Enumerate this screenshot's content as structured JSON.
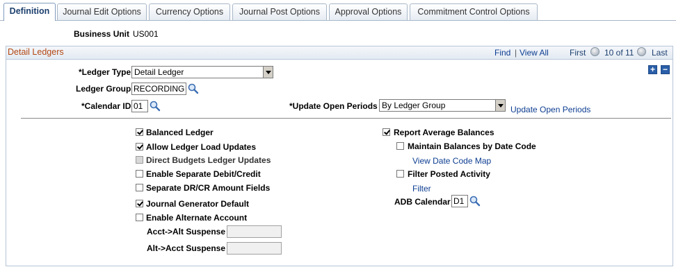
{
  "tabs": [
    {
      "label": "Definition",
      "active": true
    },
    {
      "label": "Journal Edit Options",
      "active": false
    },
    {
      "label": "Currency Options",
      "active": false
    },
    {
      "label": "Journal Post Options",
      "active": false
    },
    {
      "label": "Approval Options",
      "active": false
    },
    {
      "label": "Commitment Control Options",
      "active": false
    }
  ],
  "business_unit": {
    "label": "Business Unit",
    "value": "US001"
  },
  "detail_ledgers": {
    "title": "Detail Ledgers",
    "find": "Find",
    "view_all": "View All",
    "separator": "|",
    "first": "First",
    "counter": "10 of 11",
    "last": "Last",
    "ledger_type": {
      "label": "*Ledger Type",
      "value": "Detail Ledger"
    },
    "ledger_group": {
      "label": "Ledger Group",
      "value": "RECORDING"
    },
    "calendar_id": {
      "label": "*Calendar ID",
      "value": "01"
    },
    "update_open_periods": {
      "label": "*Update Open Periods",
      "value": "By Ledger Group",
      "link": "Update Open Periods"
    }
  },
  "left_options": {
    "balanced_ledger": {
      "label": "Balanced Ledger",
      "checked": true
    },
    "allow_load_updates": {
      "label": "Allow Ledger Load Updates",
      "checked": true
    },
    "direct_budgets": {
      "label": "Direct Budgets Ledger Updates",
      "checked": false,
      "disabled": true
    },
    "separate_debit_credit": {
      "label": "Enable Separate Debit/Credit",
      "checked": false
    },
    "separate_amount_fields": {
      "label": "Separate DR/CR Amount Fields",
      "checked": false
    },
    "journal_generator_default": {
      "label": "Journal Generator Default",
      "checked": true
    },
    "alternate_account": {
      "label": "Enable Alternate Account",
      "checked": false
    },
    "acct_alt_suspense": {
      "label": "Acct->Alt Suspense",
      "value": ""
    },
    "alt_acct_suspense": {
      "label": "Alt->Acct Suspense",
      "value": ""
    }
  },
  "right_options": {
    "report_average_balances": {
      "label": "Report Average Balances",
      "checked": true
    },
    "maintain_balances": {
      "label": "Maintain Balances by Date Code",
      "checked": false
    },
    "view_date_code_map": "View Date Code Map",
    "filter_posted_activity": {
      "label": "Filter Posted Activity",
      "checked": false
    },
    "filter_link": "Filter",
    "adb_calendar": {
      "label": "ADB Calendar",
      "value": "D1"
    }
  },
  "colors": {
    "section_title": "#b44712",
    "link": "#0d3d91",
    "tab_border": "#a7b6c8"
  }
}
